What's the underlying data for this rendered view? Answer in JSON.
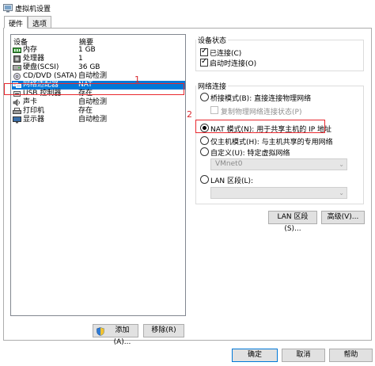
{
  "window": {
    "title": "虚拟机设置"
  },
  "tabs": [
    {
      "label": "硬件"
    },
    {
      "label": "选项"
    }
  ],
  "device_list": {
    "columns": {
      "device": "设备",
      "summary": "摘要"
    },
    "rows": [
      {
        "name": "内存",
        "summary": "1 GB",
        "icon": "memory-icon"
      },
      {
        "name": "处理器",
        "summary": "1",
        "icon": "cpu-icon"
      },
      {
        "name": "硬盘(SCSI)",
        "summary": "36 GB",
        "icon": "hard-disk-icon"
      },
      {
        "name": "CD/DVD (SATA)",
        "summary": "自动检测",
        "icon": "cd-dvd-icon"
      },
      {
        "name": "网络适配器",
        "summary": "NAT",
        "icon": "network-adapter-icon"
      },
      {
        "name": "USB 控制器",
        "summary": "存在",
        "icon": "usb-icon"
      },
      {
        "name": "声卡",
        "summary": "自动检测",
        "icon": "sound-card-icon"
      },
      {
        "name": "打印机",
        "summary": "存在",
        "icon": "printer-icon"
      },
      {
        "name": "显示器",
        "summary": "自动检测",
        "icon": "display-icon"
      }
    ],
    "selected_index": 4
  },
  "annotations": {
    "marker1": "1",
    "marker2": "2",
    "color": "#e8282e"
  },
  "device_status": {
    "title": "设备状态",
    "connected": {
      "label": "已连接(C)",
      "checked": true
    },
    "connect_at_power_on": {
      "label": "启动时连接(O)",
      "checked": true
    }
  },
  "network_connection": {
    "title": "网络连接",
    "bridged": {
      "label": "桥接模式(B): 直接连接物理网络",
      "checked": false
    },
    "replicate_state": {
      "label": "复制物理网络连接状态(P)",
      "checked": false,
      "disabled": true
    },
    "nat": {
      "label": "NAT 模式(N): 用于共享主机的 IP 地址",
      "checked": true
    },
    "host_only": {
      "label": "仅主机模式(H): 与主机共享的专用网络",
      "checked": false
    },
    "custom": {
      "label": "自定义(U): 特定虚拟网络",
      "checked": false
    },
    "custom_select": {
      "value": "VMnet0"
    },
    "lan_segment": {
      "label": "LAN 区段(L):",
      "checked": false
    },
    "lan_select": {
      "value": ""
    }
  },
  "buttons": {
    "lan_segment": "LAN 区段(S)...",
    "advanced": "高级(V)...",
    "add": "添加(A)...",
    "remove": "移除(R)",
    "ok": "确定",
    "cancel": "取消",
    "help": "帮助"
  },
  "colors": {
    "selection": "#0078d7",
    "highlight_box": "#e8282e"
  }
}
